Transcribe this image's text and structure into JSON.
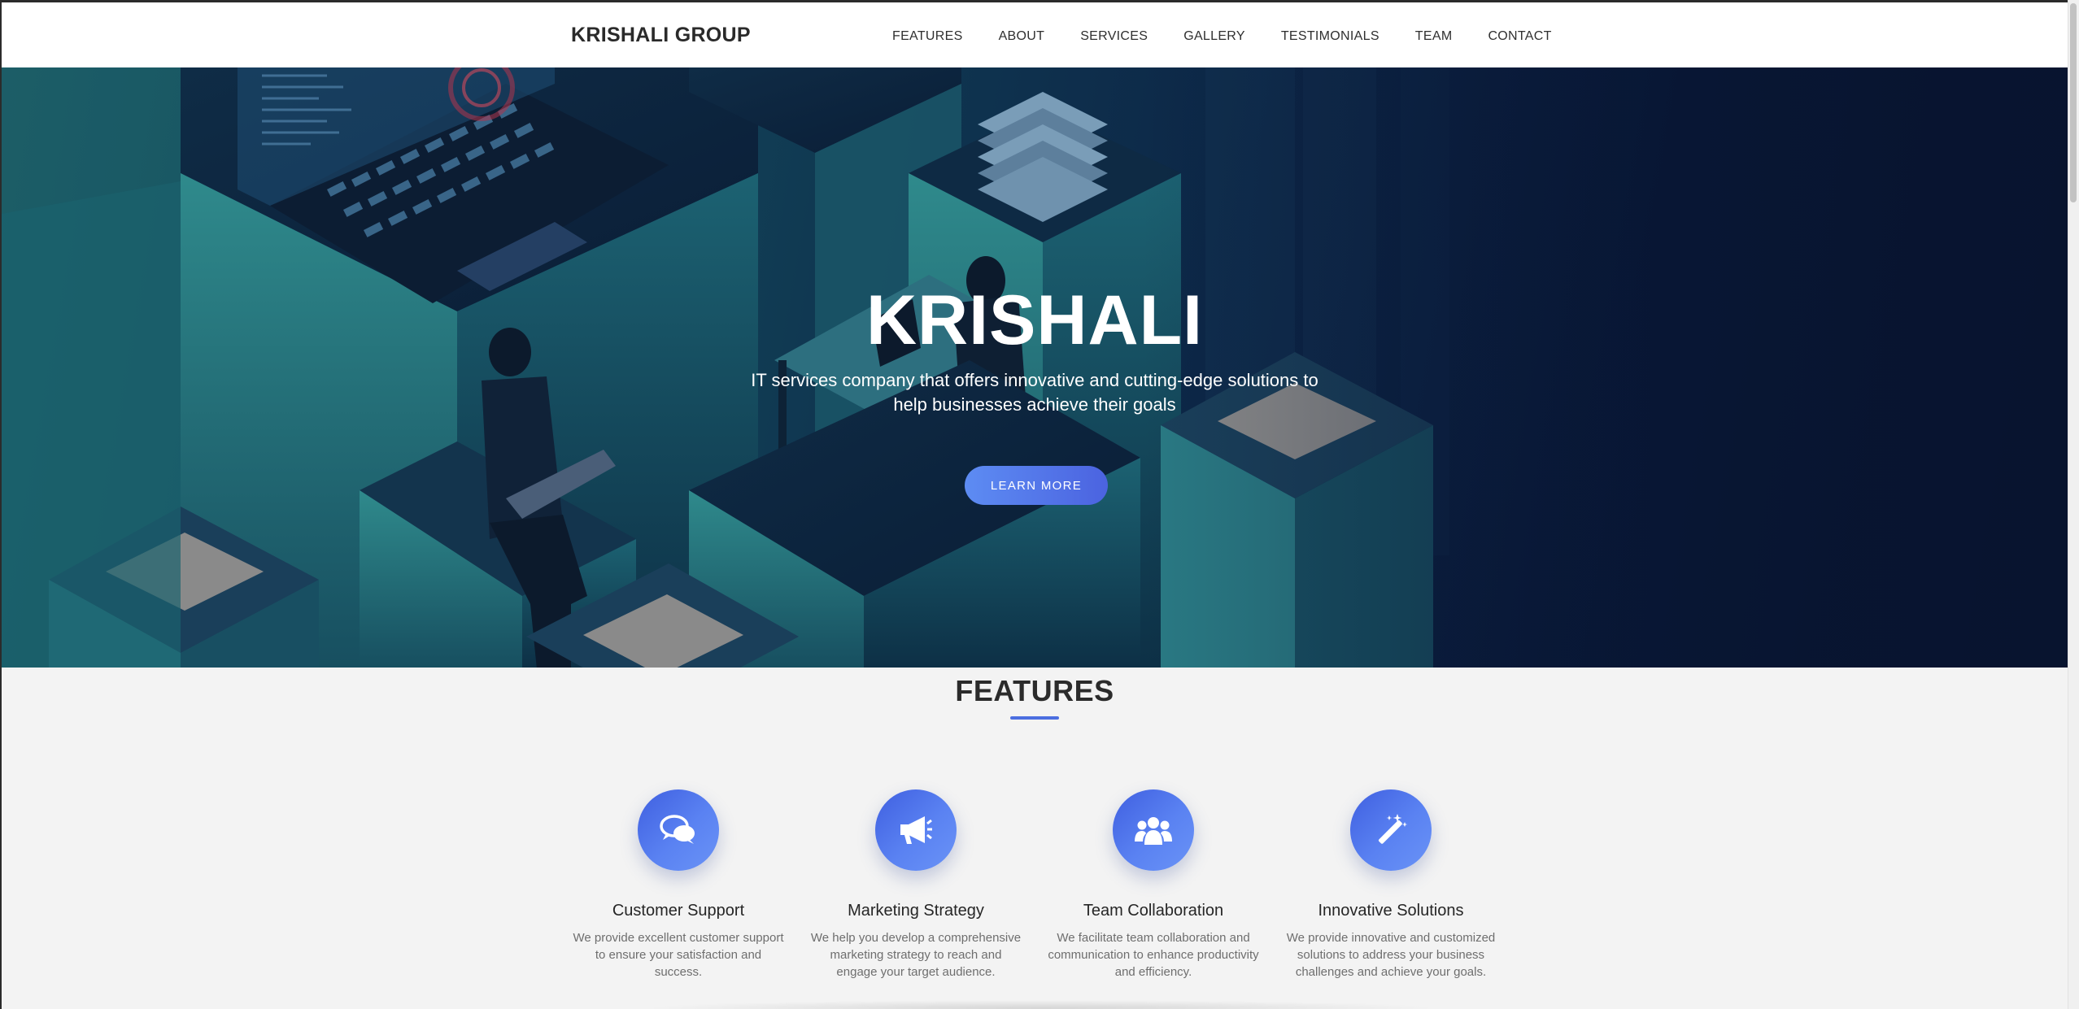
{
  "navbar": {
    "brand": "KRISHALI GROUP",
    "links": [
      "FEATURES",
      "ABOUT",
      "SERVICES",
      "GALLERY",
      "TESTIMONIALS",
      "TEAM",
      "CONTACT"
    ]
  },
  "hero": {
    "title": "KRISHALI",
    "subtitle": "IT services company that offers innovative and cutting-edge solutions to help businesses achieve their goals",
    "button_label": "LEARN MORE"
  },
  "features": {
    "title": "FEATURES",
    "items": [
      {
        "icon": "chat-bubbles-icon",
        "title": "Customer Support",
        "description": "We provide excellent customer support to ensure your satisfaction and success."
      },
      {
        "icon": "megaphone-icon",
        "title": "Marketing Strategy",
        "description": "We help you develop a comprehensive marketing strategy to reach and engage your target audience."
      },
      {
        "icon": "users-group-icon",
        "title": "Team Collaboration",
        "description": "We facilitate team collaboration and communication to enhance productivity and efficiency."
      },
      {
        "icon": "magic-wand-icon",
        "title": "Innovative Solutions",
        "description": "We provide innovative and customized solutions to address your business challenges and achieve your goals."
      }
    ]
  },
  "colors": {
    "accent": "#4b6ee0",
    "button_gradient_start": "#5d8cf3",
    "button_gradient_end": "#4b63e0",
    "hero_dark": "#08142f",
    "hero_teal": "#1c5d66"
  }
}
